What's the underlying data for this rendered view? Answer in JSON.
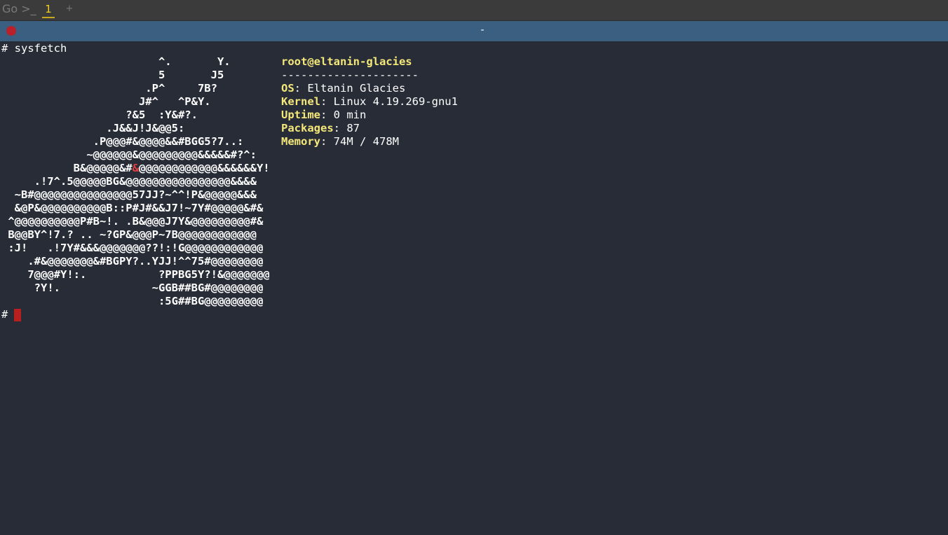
{
  "topbar": {
    "app_name": "Go >_",
    "tab_label": "1",
    "add_tab_label": "+"
  },
  "window": {
    "title": "-"
  },
  "terminal": {
    "prompt_symbol": "#",
    "command": "# sysfetch",
    "logo_lines": [
      "                        ^.       Y.",
      "                        5       J5",
      "                      .P^     7B?",
      "                     J#^   ^P&Y.",
      "                   ?&5  :Y&#?.",
      "                .J&&J!J&@@5:",
      "              .P@@@#&@@@@&&#BGG5?7..:",
      "             ~@@@@@@&@@@@@@@@@&&&&&#?^:",
      "           B&@@@@@&#",
      "     .!7^.5@@@@@BG&@@@@@@@@@@@@@@@@&&&&",
      "  ~B#@@@@@@@@@@@@@@@57JJ?~^^!P&@@@@@&&&",
      "  &@P&@@@@@@@@@@B::P#J#&&J7!~7Y#@@@@@&#&",
      " ^@@@@@@@@@@P#B~!. .B&@@@J7Y&@@@@@@@@@#&",
      " B@@BY^!7.? .. ~?GP&@@@P~7B@@@@@@@@@@@@",
      " :J!   .!7Y#&&&@@@@@@@??!:!G@@@@@@@@@@@@",
      "    .#&@@@@@@@&#BGPY?..YJJ!^^75#@@@@@@@@",
      "    7@@@#Y!:.           ?PPBG5Y?!&@@@@@@@",
      "     ?Y!.              ~GGB##BG#@@@@@@@@",
      "                        :5G##BG@@@@@@@@@"
    ],
    "logo_line9_highlight": "&",
    "logo_line9_rest": "@@@@@@@@@@@@&&&&&&Y!",
    "user_host": "root@eltanin-glacies",
    "separator": "---------------------",
    "info": [
      {
        "key": "OS",
        "value": ": Eltanin Glacies"
      },
      {
        "key": "Kernel",
        "value": ": Linux 4.19.269-gnu1"
      },
      {
        "key": "Uptime",
        "value": ": 0 min"
      },
      {
        "key": "Packages",
        "value": ": 87"
      },
      {
        "key": "Memory",
        "value": ": 74M / 478M"
      }
    ],
    "colors": {
      "background": "#282c37",
      "accent_yellow": "#f4e87a",
      "highlight_red": "#e44040",
      "titlebar": "#3a5f80",
      "cursor": "#b82020"
    }
  }
}
